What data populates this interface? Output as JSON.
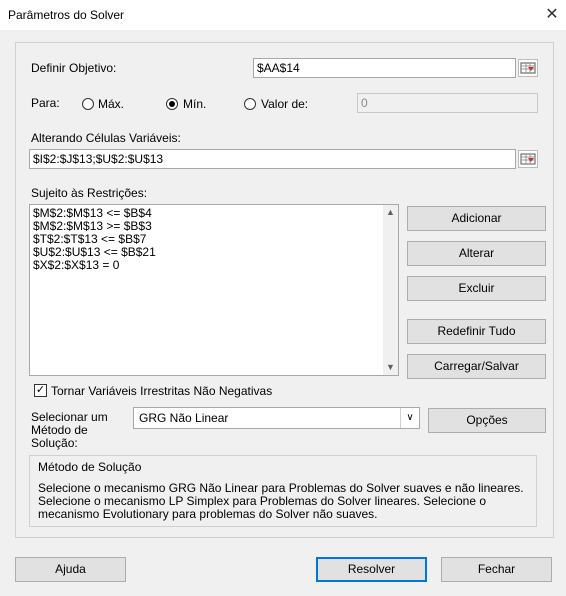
{
  "window": {
    "title": "Parâmetros do Solver",
    "close_icon": "close-icon"
  },
  "objective": {
    "label": "Definir Objetivo:",
    "value": "$AA$14"
  },
  "para": {
    "label": "Para:",
    "options": [
      "Máx.",
      "Mín.",
      "Valor de:"
    ],
    "selected": "Mín.",
    "valor_de_value": "0"
  },
  "variable_cells": {
    "label": "Alterando Células Variáveis:",
    "value": "$I$2:$J$13;$U$2:$U$13"
  },
  "constraints": {
    "label": "Sujeito às Restrições:",
    "items": [
      "$M$2:$M$13 <= $B$4",
      "$M$2:$M$13 >= $B$3",
      "$T$2:$T$13 <= $B$7",
      "$U$2:$U$13 <= $B$21",
      "$X$2:$X$13 = 0"
    ]
  },
  "side_buttons": {
    "add": "Adicionar",
    "change": "Alterar",
    "delete": "Excluir",
    "reset": "Redefinir Tudo",
    "load_save": "Carregar/Salvar"
  },
  "nonneg": {
    "label": "Tornar Variáveis Irrestritas Não Negativas",
    "checked": true
  },
  "method": {
    "label": "Selecionar um Método de Solução:",
    "selected": "GRG Não Linear",
    "options_button": "Opções"
  },
  "method_info": {
    "title": "Método de Solução",
    "text": "Selecione o mecanismo GRG Não Linear para Problemas do Solver suaves e não lineares. Selecione o mecanismo LP Simplex para Problemas do Solver lineares. Selecione o mecanismo Evolutionary para problemas do Solver não suaves."
  },
  "footer": {
    "help": "Ajuda",
    "solve": "Resolver",
    "close": "Fechar"
  },
  "colors": {
    "accent": "#0078d7",
    "ref_icon_red": "#c0392b"
  }
}
